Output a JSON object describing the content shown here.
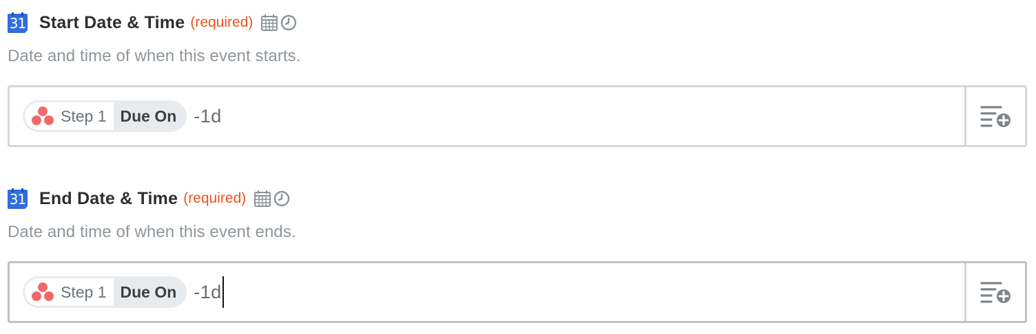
{
  "fields": [
    {
      "app_icon": "google-calendar-icon",
      "app_icon_text": "31",
      "label": "Start Date & Time",
      "required_text": "(required)",
      "type_icons": [
        "calendar-icon",
        "clock-icon"
      ],
      "description": "Date and time of when this event starts.",
      "pill": {
        "app_icon": "asana-icon",
        "step_label": "Step 1",
        "field_label": "Due On"
      },
      "typed_value": "-1d",
      "insert_data_icon": "insert-data-icon"
    },
    {
      "app_icon": "google-calendar-icon",
      "app_icon_text": "31",
      "label": "End Date & Time",
      "required_text": "(required)",
      "type_icons": [
        "calendar-icon",
        "clock-icon"
      ],
      "description": "Date and time of when this event ends.",
      "pill": {
        "app_icon": "asana-icon",
        "step_label": "Step 1",
        "field_label": "Due On"
      },
      "typed_value": "-1d",
      "focused": true,
      "insert_data_icon": "insert-data-icon"
    }
  ],
  "colors": {
    "required": "#e8541f",
    "description": "#8f969a",
    "google_calendar_blue": "#2f6de0",
    "asana_coral": "#f06a6a",
    "border": "#d3d8db"
  }
}
